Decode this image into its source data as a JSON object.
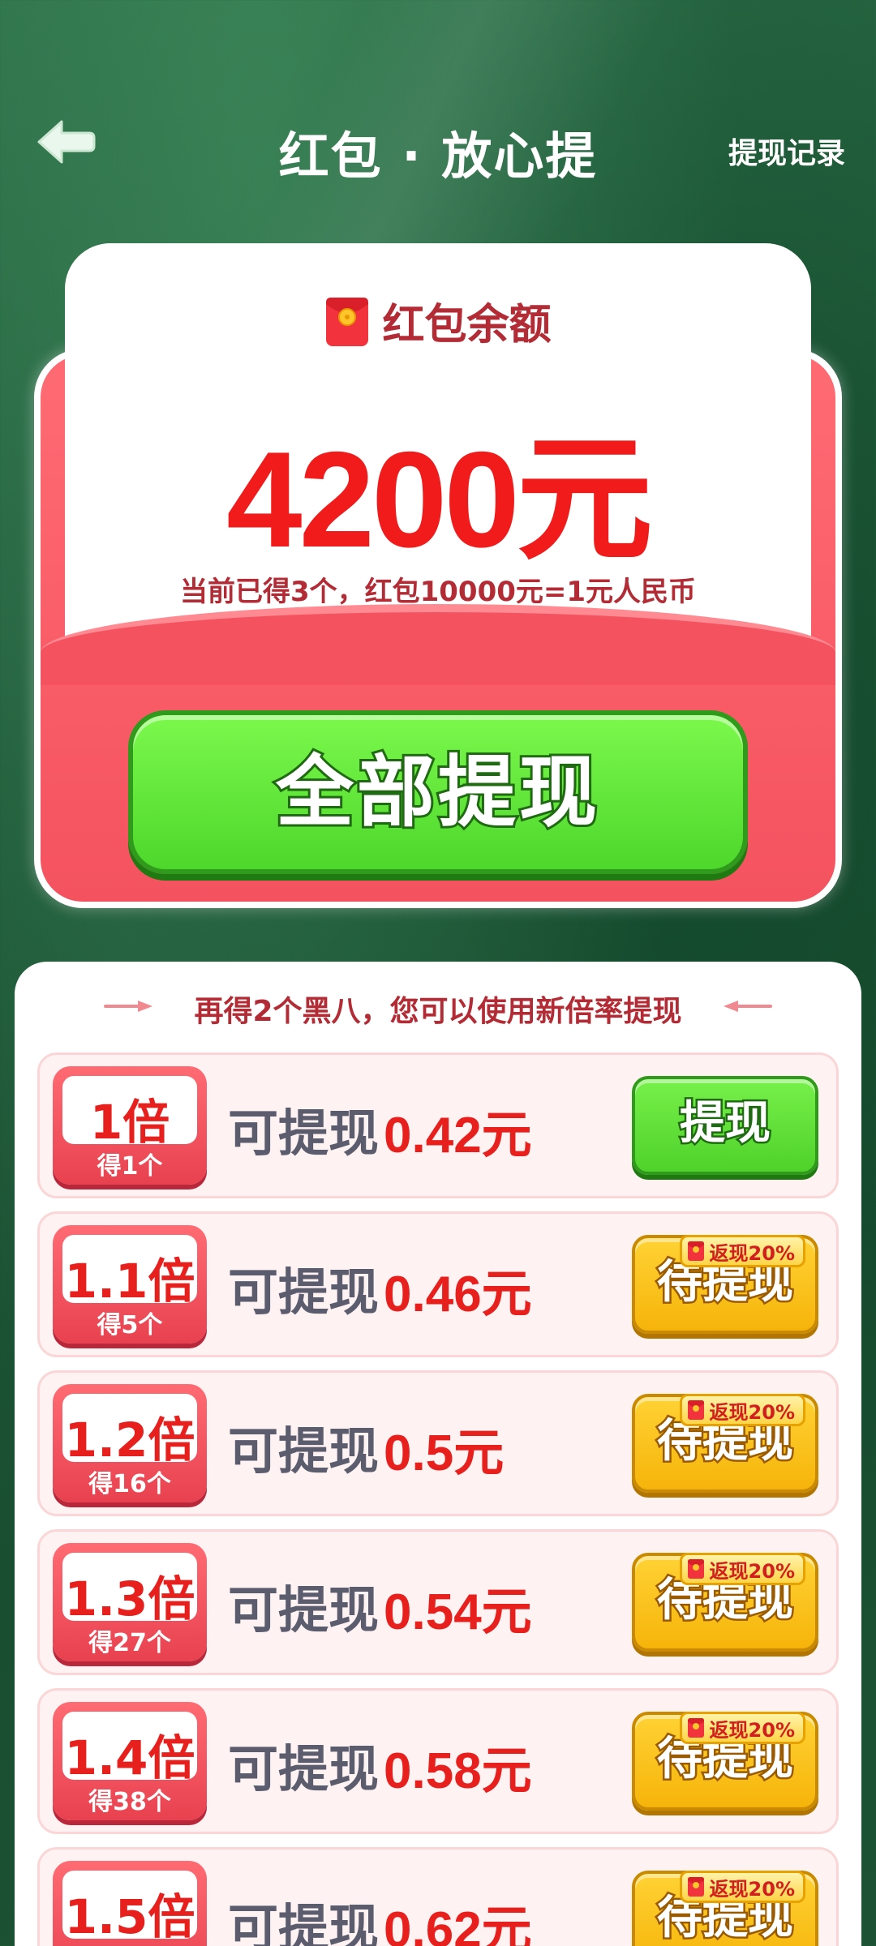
{
  "header": {
    "title": "红包 · 放心提",
    "history_link": "提现记录"
  },
  "balance": {
    "label": "红包余额",
    "amount": "4200元",
    "note": "当前已得3个，红包10000元=1元人民币",
    "withdraw_all": "全部提现"
  },
  "tiers": {
    "hint": "再得2个黑八，您可以使用新倍率提现",
    "withdraw_prefix": "可提现",
    "rows": [
      {
        "multiplier": "1倍",
        "count": "得1个",
        "amount": "0.42元",
        "action": "提现",
        "style": "green",
        "cashback": ""
      },
      {
        "multiplier": "1.1倍",
        "count": "得5个",
        "amount": "0.46元",
        "action": "待提现",
        "style": "yellow",
        "cashback": "返现20%"
      },
      {
        "multiplier": "1.2倍",
        "count": "得16个",
        "amount": "0.5元",
        "action": "待提现",
        "style": "yellow",
        "cashback": "返现20%"
      },
      {
        "multiplier": "1.3倍",
        "count": "得27个",
        "amount": "0.54元",
        "action": "待提现",
        "style": "yellow",
        "cashback": "返现20%"
      },
      {
        "multiplier": "1.4倍",
        "count": "得38个",
        "amount": "0.58元",
        "action": "待提现",
        "style": "yellow",
        "cashback": "返现20%"
      },
      {
        "multiplier": "1.5倍",
        "count": "",
        "amount": "0.62元",
        "action": "待提现",
        "style": "yellow",
        "cashback": "返现20%"
      }
    ]
  },
  "icons": {
    "back": "back-arrow-icon",
    "red_packet": "red-packet-icon"
  },
  "colors": {
    "background": "#1f5a39",
    "accent_red": "#e8201d",
    "card_red": "#f4525f",
    "button_green": "#4fd22a",
    "button_yellow": "#f6b40a"
  }
}
